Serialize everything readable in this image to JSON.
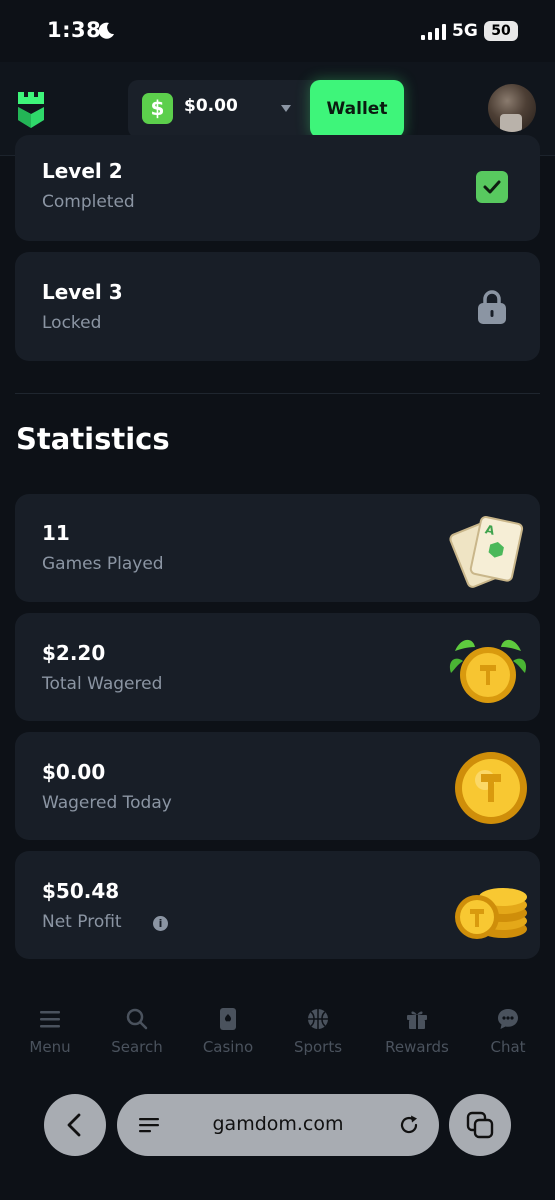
{
  "status_bar": {
    "time": "1:38",
    "network": "5G",
    "battery": "50"
  },
  "header": {
    "balance": "$0.00",
    "currency_symbol": "$",
    "wallet_label": "Wallet"
  },
  "levels": [
    {
      "title": "Level 2",
      "status": "Completed",
      "icon": "check-icon"
    },
    {
      "title": "Level 3",
      "status": "Locked",
      "icon": "lock-icon"
    }
  ],
  "statistics": {
    "title": "Statistics",
    "items": [
      {
        "value": "11",
        "label": "Games Played",
        "icon": "cards-icon"
      },
      {
        "value": "$2.20",
        "label": "Total Wagered",
        "icon": "coin-leaves-icon"
      },
      {
        "value": "$0.00",
        "label": "Wagered Today",
        "icon": "coin-icon"
      },
      {
        "value": "$50.48",
        "label": "Net Profit",
        "icon": "coin-stack-icon",
        "info": "i"
      }
    ]
  },
  "bottom_nav": [
    {
      "label": "Menu",
      "icon": "menu-icon"
    },
    {
      "label": "Search",
      "icon": "search-icon"
    },
    {
      "label": "Casino",
      "icon": "casino-icon"
    },
    {
      "label": "Sports",
      "icon": "sports-icon"
    },
    {
      "label": "Rewards",
      "icon": "gift-icon"
    },
    {
      "label": "Chat",
      "icon": "chat-icon"
    }
  ],
  "browser": {
    "url": "gamdom.com"
  },
  "colors": {
    "accent": "#3ef57a",
    "card": "#181e27",
    "background": "#0d1117",
    "muted": "#8b95a3"
  }
}
